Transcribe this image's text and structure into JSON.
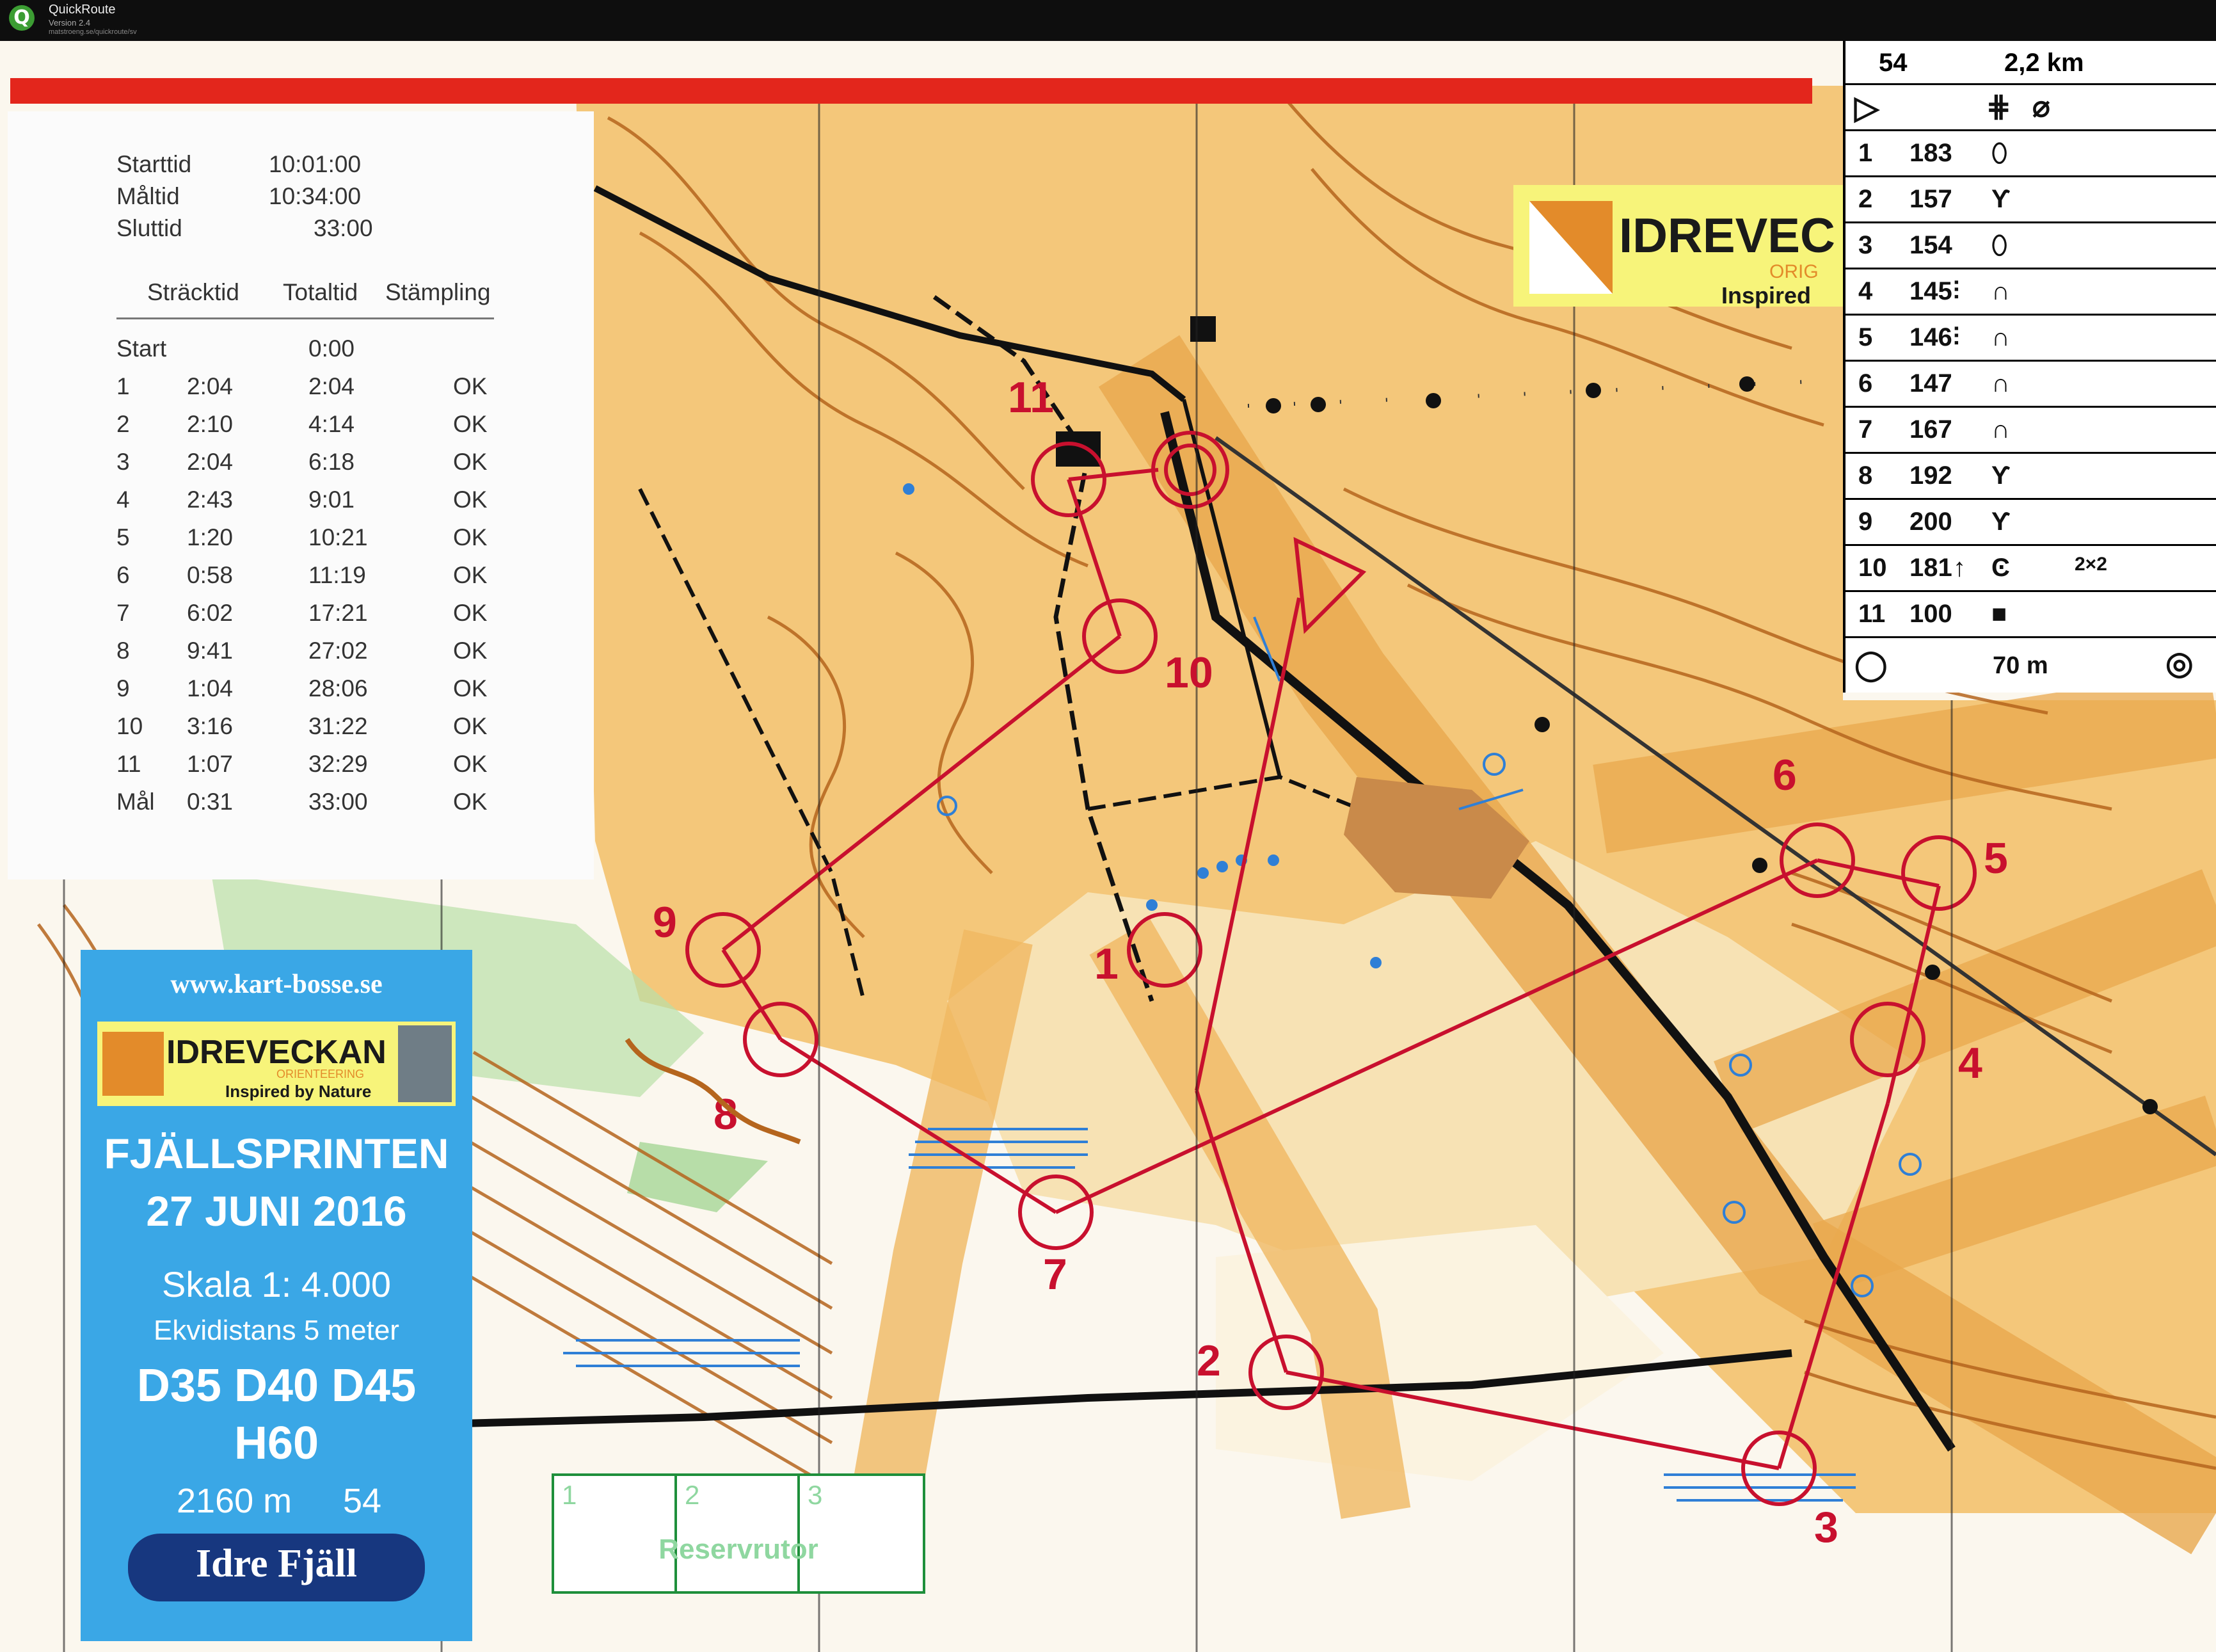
{
  "app": {
    "title": "QuickRoute",
    "version": "Version 2.4",
    "url": "matstroeng.se/quickroute/sv"
  },
  "colors": {
    "map_paper": "#fbf7ee",
    "open_land": "#f4c77a",
    "rough_open": "#e9a84e",
    "contour": "#b5651d",
    "course": "#c8102e",
    "water": "#2f7fd6",
    "vegetation_green": "#9ad28a",
    "route_red": "#d7241f",
    "info_blue": "#3aa7e6"
  },
  "splits": {
    "start_time_label": "Starttid",
    "start_time": "10:01:00",
    "finish_time_label": "Måltid",
    "finish_time": "10:34:00",
    "total_label": "Sluttid",
    "total_time": "33:00",
    "columns": [
      "Sträcktid",
      "Totaltid",
      "Stämpling"
    ],
    "rows": [
      {
        "control": "Start",
        "leg": "",
        "total": "0:00",
        "status": ""
      },
      {
        "control": "1",
        "leg": "2:04",
        "total": "2:04",
        "status": "OK"
      },
      {
        "control": "2",
        "leg": "2:10",
        "total": "4:14",
        "status": "OK"
      },
      {
        "control": "3",
        "leg": "2:04",
        "total": "6:18",
        "status": "OK"
      },
      {
        "control": "4",
        "leg": "2:43",
        "total": "9:01",
        "status": "OK"
      },
      {
        "control": "5",
        "leg": "1:20",
        "total": "10:21",
        "status": "OK"
      },
      {
        "control": "6",
        "leg": "0:58",
        "total": "11:19",
        "status": "OK"
      },
      {
        "control": "7",
        "leg": "6:02",
        "total": "17:21",
        "status": "OK"
      },
      {
        "control": "8",
        "leg": "9:41",
        "total": "27:02",
        "status": "OK"
      },
      {
        "control": "9",
        "leg": "1:04",
        "total": "28:06",
        "status": "OK"
      },
      {
        "control": "10",
        "leg": "3:16",
        "total": "31:22",
        "status": "OK"
      },
      {
        "control": "11",
        "leg": "1:07",
        "total": "32:29",
        "status": "OK"
      },
      {
        "control": "Mål",
        "leg": "0:31",
        "total": "33:00",
        "status": "OK"
      }
    ]
  },
  "clue_sheet": {
    "course": "54",
    "length": "2,2 km",
    "controls": [
      {
        "n": "1",
        "code": "183",
        "symbol": "⬯",
        "detail": "",
        "extra": ""
      },
      {
        "n": "2",
        "code": "157",
        "symbol": "Ƴ",
        "detail": "",
        "extra": ""
      },
      {
        "n": "3",
        "code": "154",
        "symbol": "⬯",
        "detail": "",
        "extra": ""
      },
      {
        "n": "4",
        "code": "145",
        "symbol": "∩",
        "detail": "⫶",
        "extra": ""
      },
      {
        "n": "5",
        "code": "146",
        "symbol": "∩",
        "detail": "⫶",
        "extra": ""
      },
      {
        "n": "6",
        "code": "147",
        "symbol": "∩",
        "detail": "",
        "extra": ""
      },
      {
        "n": "7",
        "code": "167",
        "symbol": "∩",
        "detail": "",
        "extra": ""
      },
      {
        "n": "8",
        "code": "192",
        "symbol": "Ƴ",
        "detail": "",
        "extra": ""
      },
      {
        "n": "9",
        "code": "200",
        "symbol": "Ƴ",
        "detail": "",
        "extra": ""
      },
      {
        "n": "10",
        "code": "181",
        "symbol": "Ͼ",
        "detail": "↑",
        "extra": "2×2"
      },
      {
        "n": "11",
        "code": "100",
        "symbol": "■",
        "detail": "",
        "extra": ""
      }
    ],
    "finish_distance": "70 m"
  },
  "event": {
    "website": "www.kart-bosse.se",
    "logo_title": "IDREVECKAN",
    "logo_sub": "ORIENTEERING",
    "logo_tagline": "Inspired by Nature",
    "name": "FJÄLLSPRINTEN",
    "date": "27 JUNI 2016",
    "scale": "Skala 1: 4.000",
    "contour": "Ekvidistans 5 meter",
    "classes_1": "D35 D40 D45",
    "classes_2": "H60",
    "length": "2160 m",
    "course_no": "54",
    "sponsor": "Idre Fjäll"
  },
  "map_banner": {
    "title": "IDREVEC",
    "sub": "ORIG",
    "tagline": "Inspired"
  },
  "reserve": {
    "cells": [
      "1",
      "2",
      "3"
    ],
    "label": "Reservrutor"
  },
  "course_labels": {
    "c1": "1",
    "c2": "2",
    "c3": "3",
    "c4": "4",
    "c5": "5",
    "c6": "6",
    "c7": "7",
    "c8": "8",
    "c9": "9",
    "c10": "10",
    "c11": "11"
  }
}
